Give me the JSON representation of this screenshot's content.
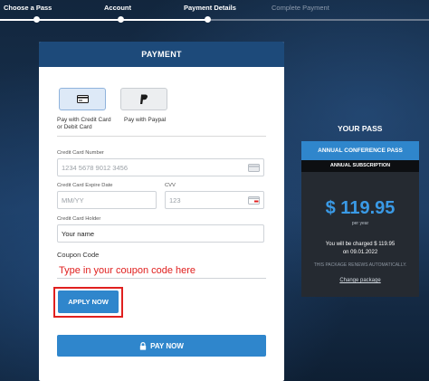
{
  "stepper": {
    "steps": [
      {
        "label": "Choose a Pass",
        "state": "done"
      },
      {
        "label": "Account",
        "state": "done"
      },
      {
        "label": "Payment Details",
        "state": "current"
      },
      {
        "label": "Complete Payment",
        "state": "upcoming"
      }
    ]
  },
  "payment": {
    "title": "PAYMENT",
    "methods": [
      {
        "label_line1": "Pay with Credit Card",
        "label_line2": "or Debit Card",
        "icon": "credit-card-icon",
        "selected": true
      },
      {
        "label_line1": "Pay with Paypal",
        "icon": "paypal-icon",
        "selected": false
      }
    ],
    "card_number": {
      "label": "Credit Card Number",
      "placeholder": "1234 5678 9012 3456",
      "value": ""
    },
    "expire": {
      "label": "Credit Card Expire Date",
      "placeholder": "MM/YY",
      "value": ""
    },
    "cvv": {
      "label": "CVV",
      "placeholder": "123",
      "value": ""
    },
    "holder": {
      "label": "Credit Card Holder",
      "placeholder": "",
      "value": "Your name"
    },
    "coupon": {
      "label": "Coupon Code",
      "hint": "Type in your coupon code here",
      "apply_label": "APPLY NOW"
    },
    "pay_label": "PAY NOW"
  },
  "pass": {
    "heading": "YOUR PASS",
    "name": "ANNUAL CONFERENCE PASS",
    "type": "ANNUAL SUBSCRIPTION",
    "price": "$ 119.95",
    "period": "per year",
    "charge_line1": "You will be charged $ 119.95",
    "charge_line2": "on 09.01.2022",
    "renew_note": "THIS PACKAGE RENEWS AUTOMATICALLY.",
    "change_link": "Change package"
  },
  "colors": {
    "accent": "#2f86cc",
    "header": "#1d4a7a",
    "highlight": "#e0201f"
  }
}
